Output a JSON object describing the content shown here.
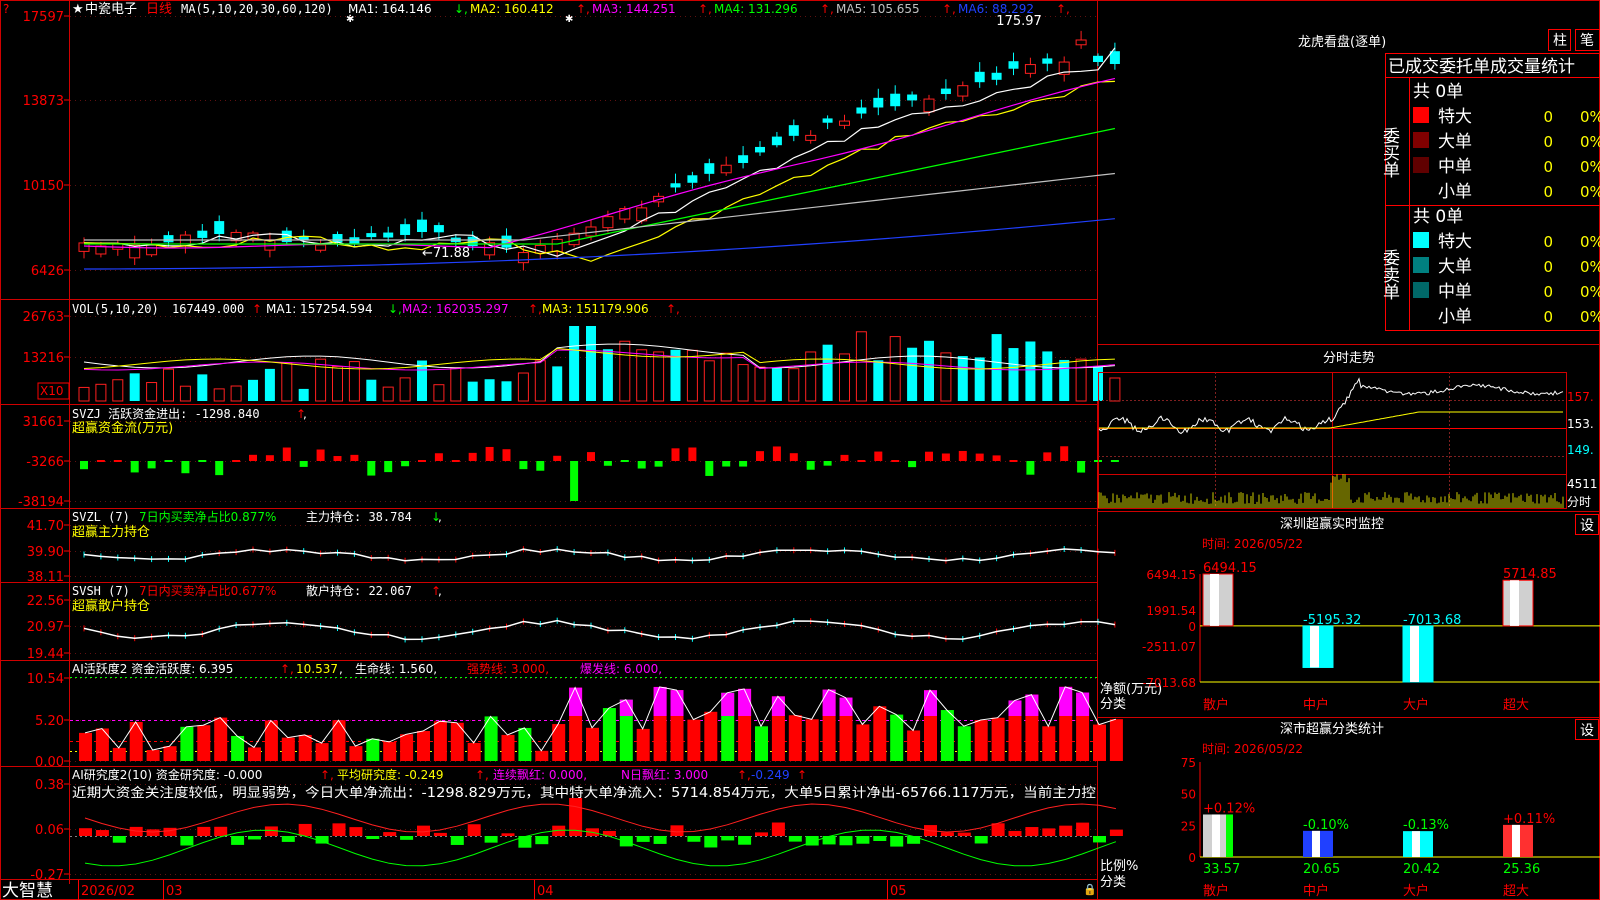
{
  "stock": {
    "marker": "★",
    "name": "中瓷电子",
    "period": "日线"
  },
  "kline": {
    "ma_params": "MA(5,10,20,30,60,120)",
    "ma_values": [
      {
        "label": "MA1: 164.146",
        "arrow": "↓",
        "color": "#ffffff"
      },
      {
        "label": "MA2: 160.412",
        "arrow": "↑",
        "color": "#ffff00"
      },
      {
        "label": "MA3: 144.251",
        "arrow": "↑",
        "color": "#ff00ff"
      },
      {
        "label": "MA4: 131.296",
        "arrow": "↑",
        "color": "#00ff00"
      },
      {
        "label": "MA5: 105.655",
        "arrow": "↑",
        "color": "#c0c0c0"
      },
      {
        "label": "MA6: 88.292",
        "arrow": "↑",
        "color": "#2040ff"
      }
    ],
    "y_ticks": [
      "17597",
      "13873",
      "10150",
      "6426"
    ],
    "high_label": "175.97",
    "low_label": "71.88",
    "marks": [
      "✱",
      "✱"
    ]
  },
  "vol": {
    "header": "VOL(5,10,20)",
    "value": "167449.000",
    "ma": [
      {
        "label": "MA1: 157254.594",
        "arrow": "↓",
        "color": "#ffffff"
      },
      {
        "label": "MA2: 162035.297",
        "arrow": "↑",
        "color": "#ff00ff"
      },
      {
        "label": "MA3: 151179.906",
        "arrow": "↑",
        "color": "#ffff00"
      }
    ],
    "y_ticks": [
      "26763",
      "13216"
    ],
    "unit": "X10"
  },
  "svzj": {
    "line1": "SVZJ  活跃资金进出: -1298.840",
    "arrow": "↑",
    "tail": ",",
    "line2": "超赢资金流(万元)",
    "y_ticks": [
      "31661",
      "-3266",
      "-38194"
    ]
  },
  "svzl": {
    "name": "SVZL (7)",
    "ratio": "7日内买卖净占比0.877%",
    "hold": "主力持仓: 38.784",
    "arrow": "↓",
    "tail": ",",
    "line2": "超赢主力持仓",
    "y_ticks": [
      "41.70",
      "39.90",
      "38.11"
    ]
  },
  "svsh": {
    "name": "SVSH (7)",
    "ratio": "7日内买卖净占比0.677%",
    "hold": "散户持仓: 22.067",
    "arrow": "↑",
    "tail": ",",
    "line2": "超赢散户持仓",
    "y_ticks": [
      "22.56",
      "20.97",
      "19.44"
    ]
  },
  "ai1": {
    "head": "AI活跃度2 资金活跃度: 6.395",
    "v2": "10.537",
    "v3": "生命线: 1.560,",
    "v4": "强势线: 3.000,",
    "v5": "爆发线: 6.000,",
    "y_ticks": [
      "10.54",
      "5.20",
      "0.00"
    ]
  },
  "ai2": {
    "head": "AI研究度2(10) 资金研究度: -0.000",
    "avg": "平均研究度: -0.249",
    "lian": "连续飘红: 0.000,",
    "nday": "N日飘红: 3.000",
    "last": "-0.249",
    "comment": "近期大资金关注度较低，明显弱势，今日大单净流出：-1298.829万元，其中特大单净流入：5714.854万元，大单5日累计净出-65766.117万元，当前主力控",
    "y_ticks": [
      "0.38",
      "0.06",
      "-0.27"
    ]
  },
  "xaxis": {
    "left": "大智慧",
    "labels": [
      "2026/02",
      "03",
      "04",
      "05"
    ]
  },
  "longhu": {
    "title": "龙虎看盘(逐单)",
    "btn1": "柱",
    "btn2": "笔",
    "tabs": "已成交委托单成交量统计",
    "buy_side": "委买单",
    "sell_side": "委卖单",
    "buy_total": "共 0单",
    "sell_total": "共 0单",
    "buy_rows": [
      {
        "name": "特大",
        "n": "0",
        "pct": "0%",
        "color": "#ff0000"
      },
      {
        "name": "大单",
        "n": "0",
        "pct": "0%",
        "color": "#800000"
      },
      {
        "name": "中单",
        "n": "0",
        "pct": "0%",
        "color": "#600000"
      },
      {
        "name": "小单",
        "n": "0",
        "pct": "0%",
        "color": ""
      }
    ],
    "sell_rows": [
      {
        "name": "特大",
        "n": "0",
        "pct": "0%",
        "color": "#00ffff"
      },
      {
        "name": "大单",
        "n": "0",
        "pct": "0%",
        "color": "#008080"
      },
      {
        "name": "中单",
        "n": "0",
        "pct": "0%",
        "color": "#006868"
      },
      {
        "name": "小单",
        "n": "0",
        "pct": "0%",
        "color": ""
      }
    ]
  },
  "intraday": {
    "title": "分时走势",
    "y_ticks": [
      "157.",
      "153.",
      "149."
    ],
    "vol_label": "4511",
    "tag": "分时"
  },
  "sz_monitor": {
    "title": "深圳超赢实时监控",
    "set": "设",
    "time": "时间: 2026/05/22",
    "y_ticks": [
      "6494.15",
      "1991.54",
      "0",
      "-2511.07",
      "-7013.68"
    ],
    "unit_a": "净额(万元)",
    "unit_b": "分类",
    "cats": [
      "散户",
      "中户",
      "大户",
      "超大"
    ],
    "bar_labels": [
      "6494.15",
      "-5195.32",
      "-7013.68",
      "5714.85"
    ]
  },
  "sz_class": {
    "title": "深市超赢分类统计",
    "set": "设",
    "time": "时间: 2026/05/22",
    "y_ticks": [
      "75",
      "50",
      "25",
      "0"
    ],
    "unit_a": "比例%",
    "unit_b": "分类",
    "cats": [
      "散户",
      "中户",
      "大户",
      "超大"
    ],
    "top_labels": [
      "+0.12%",
      "-0.10%",
      "-0.13%",
      "+0.11%"
    ],
    "bottom_labels": [
      "33.57",
      "20.65",
      "20.42",
      "25.36"
    ]
  },
  "chart_data": {
    "type": "bar",
    "title": "深圳超赢实时监控",
    "categories": [
      "散户",
      "中户",
      "大户",
      "超大"
    ],
    "values": [
      6494.15,
      -5195.32,
      -7013.68,
      5714.85
    ],
    "ylabel": "净额(万元)",
    "ylim": [
      -7013.68,
      6494.15
    ]
  }
}
